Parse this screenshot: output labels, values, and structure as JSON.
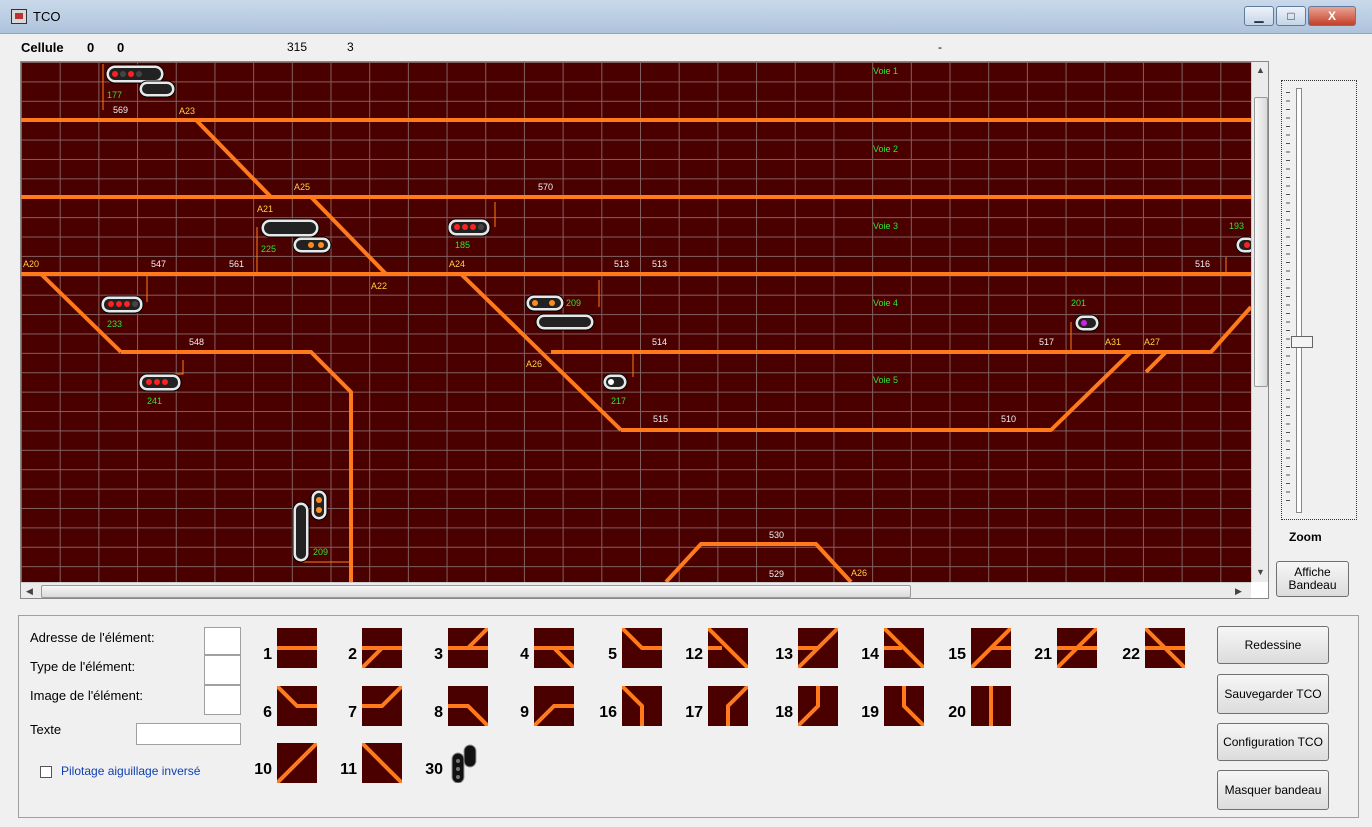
{
  "window": {
    "title": "TCO",
    "controls": [
      "▁",
      "□",
      "X"
    ]
  },
  "status": {
    "label": "Cellule",
    "v1": "0",
    "v2": "0",
    "v3": "315",
    "v4": "3",
    "v5": "-"
  },
  "tco": {
    "voies": [
      "Voie 1",
      "Voie 2",
      "Voie 3",
      "Voie 4",
      "Voie 5"
    ],
    "aiguillages": [
      "A23",
      "A25",
      "A21",
      "A22",
      "A20",
      "A24",
      "A26",
      "A31",
      "A27",
      "A26"
    ],
    "cantons": [
      "569",
      "570",
      "547",
      "561",
      "513",
      "513",
      "516",
      "548",
      "514",
      "517",
      "515",
      "510",
      "530",
      "529"
    ],
    "signaux": [
      "177",
      "185",
      "225",
      "233",
      "209",
      "201",
      "241",
      "217",
      "209",
      "193"
    ]
  },
  "zoom": {
    "label": "Zoom"
  },
  "buttons": {
    "affiche": "Affiche Bandeau",
    "redessine": "Redessine",
    "sauvegarder": "Sauvegarder TCO",
    "configuration": "Configuration TCO",
    "masquer": "Masquer bandeau"
  },
  "fields": {
    "adresse": "Adresse de l'élément:",
    "type": "Type de l'élément:",
    "image": "Image de l'élément:",
    "texte": "Texte",
    "texte_value": ""
  },
  "checkbox": {
    "label": "Pilotage aiguillage inversé",
    "checked": false
  },
  "palette": [
    {
      "num": "1",
      "kind": "h"
    },
    {
      "num": "2",
      "kind": "h-bl"
    },
    {
      "num": "3",
      "kind": "h-tr"
    },
    {
      "num": "4",
      "kind": "h-br"
    },
    {
      "num": "5",
      "kind": "h-tl"
    },
    {
      "num": "12",
      "kind": "diag-tl-split"
    },
    {
      "num": "13",
      "kind": "diag-tr-split"
    },
    {
      "num": "14",
      "kind": "diag-tl-left"
    },
    {
      "num": "15",
      "kind": "diag-bl-right"
    },
    {
      "num": "21",
      "kind": "x1"
    },
    {
      "num": "22",
      "kind": "x2"
    },
    {
      "num": "6",
      "kind": "curve-tl"
    },
    {
      "num": "7",
      "kind": "curve-tr"
    },
    {
      "num": "8",
      "kind": "curve-l"
    },
    {
      "num": "9",
      "kind": "curve-bl"
    },
    {
      "num": "16",
      "kind": "v-tl"
    },
    {
      "num": "17",
      "kind": "v-tr"
    },
    {
      "num": "18",
      "kind": "v-bl"
    },
    {
      "num": "19",
      "kind": "v-br"
    },
    {
      "num": "20",
      "kind": "v"
    },
    {
      "num": "10",
      "kind": "diag-bl"
    },
    {
      "num": "11",
      "kind": "diag-tl"
    },
    {
      "num": "30",
      "kind": "signal"
    }
  ]
}
